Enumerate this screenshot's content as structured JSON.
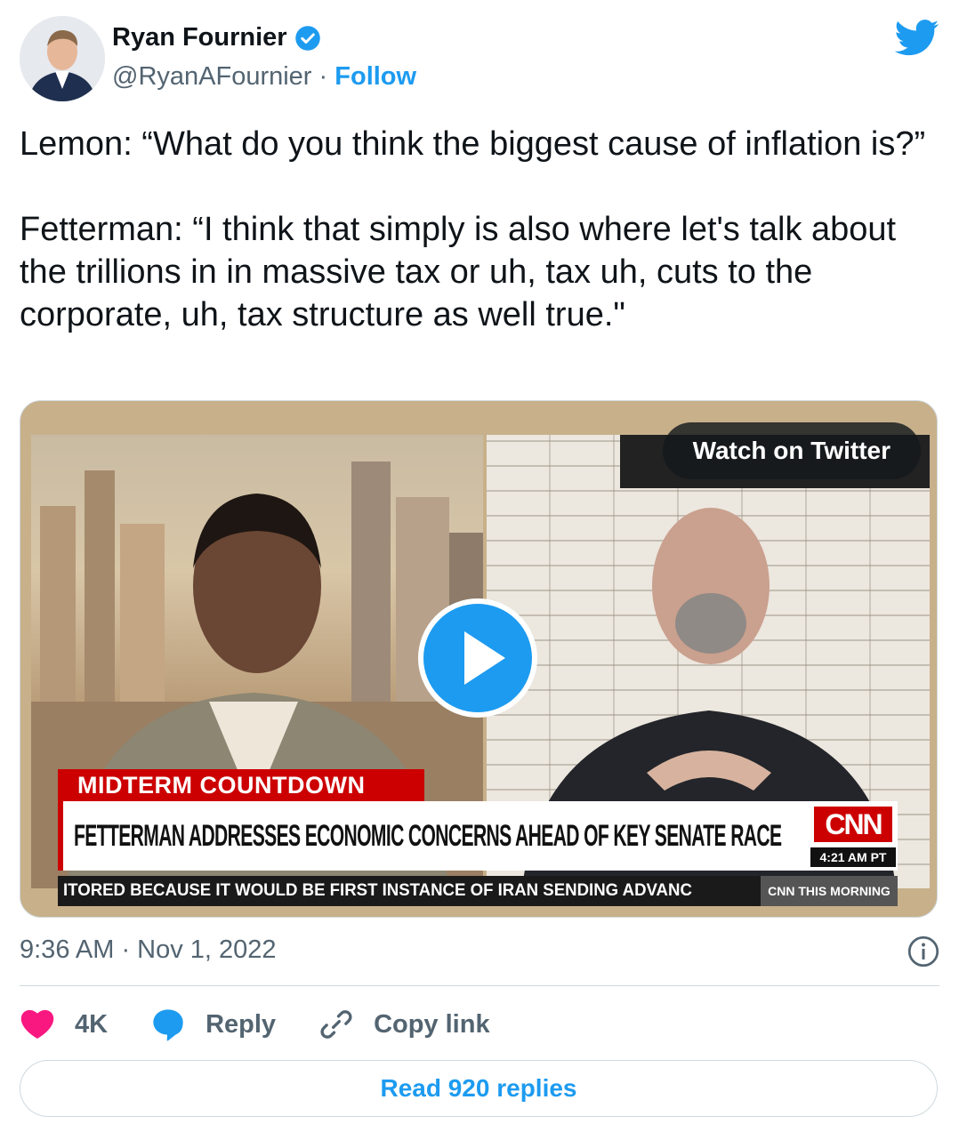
{
  "author": {
    "name": "Ryan Fournier",
    "handle": "@RyanAFournier",
    "separator": "·",
    "follow_label": "Follow"
  },
  "tweet": {
    "text": "Lemon: “What do you think the biggest cause of inflation is?”\n\nFetterman: “I think that simply is also where let's talk about the trillions in in massive tax or uh, tax uh, cuts to the corporate, uh, tax structure as well true.\""
  },
  "media": {
    "watch_label": "Watch on Twitter",
    "banner_tag": "MIDTERM COUNTDOWN",
    "banner_headline": "FETTERMAN ADDRESSES ECONOMIC CONCERNS AHEAD OF KEY SENATE RACE",
    "network_logo": "CNN",
    "clock": "4:21 AM PT",
    "ticker": "ITORED BECAUSE IT WOULD BE FIRST INSTANCE OF IRAN SENDING ADVANC",
    "ticker_brand": "CNN THIS MORNING"
  },
  "meta": {
    "timestamp": "9:36 AM · Nov 1, 2022"
  },
  "actions": {
    "likes": "4K",
    "reply_label": "Reply",
    "copy_label": "Copy link",
    "read_replies_label": "Read 920 replies"
  },
  "colors": {
    "accent": "#1d9bf0",
    "like": "#f91880",
    "cnn_red": "#cc0000"
  },
  "icons": [
    "verified-badge-icon",
    "twitter-bird-icon",
    "play-icon",
    "info-icon",
    "heart-icon",
    "reply-bubble-icon",
    "link-icon"
  ]
}
